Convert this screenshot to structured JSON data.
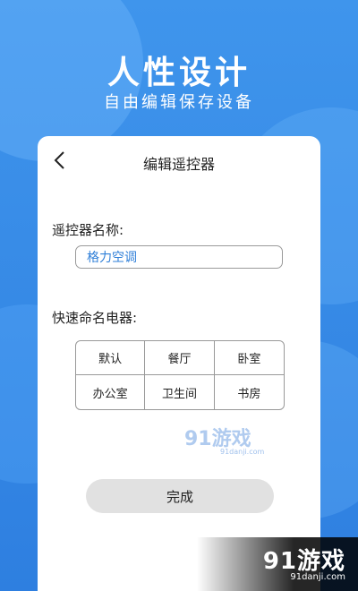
{
  "hero": {
    "title": "人性设计",
    "subtitle": "自由编辑保存设备"
  },
  "header": {
    "title": "编辑遥控器",
    "back_icon": "chevron-left-icon"
  },
  "form": {
    "name_label": "遥控器名称:",
    "name_value": "格力空调",
    "quick_label": "快速命名电器:",
    "quick_names": [
      "默认",
      "餐厅",
      "卧室",
      "办公室",
      "卫生间",
      "书房"
    ]
  },
  "watermark": {
    "text": "91游戏",
    "url": "91danji.com"
  },
  "actions": {
    "done_label": "完成"
  },
  "corner_logo": {
    "text": "91游戏",
    "url": "91danji.com"
  },
  "colors": {
    "background": "#3a8ee8",
    "accent_text": "#2f7fd8",
    "button_bg": "#e1e1e1"
  }
}
